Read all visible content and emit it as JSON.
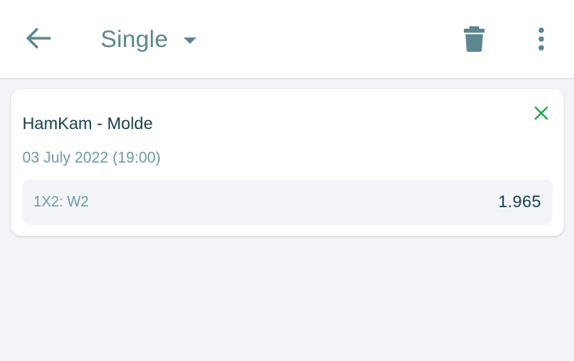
{
  "header": {
    "back_icon": "arrow-left-icon",
    "mode": "Single",
    "mode_caret_icon": "caret-down-icon",
    "delete_icon": "trash-icon",
    "more_icon": "more-vertical-icon"
  },
  "bet": {
    "match": "HamKam - Molde",
    "date": "03 July 2022 (19:00)",
    "remove_icon": "close-icon",
    "selection": {
      "market": "1X2: W2",
      "odds": "1.965"
    }
  },
  "colors": {
    "primary": "#5d8791",
    "text_dark": "#17404d",
    "text_muted": "#6f9aa4",
    "remove": "#1aa64a",
    "background": "#f3f4f8",
    "card": "#ffffff"
  }
}
